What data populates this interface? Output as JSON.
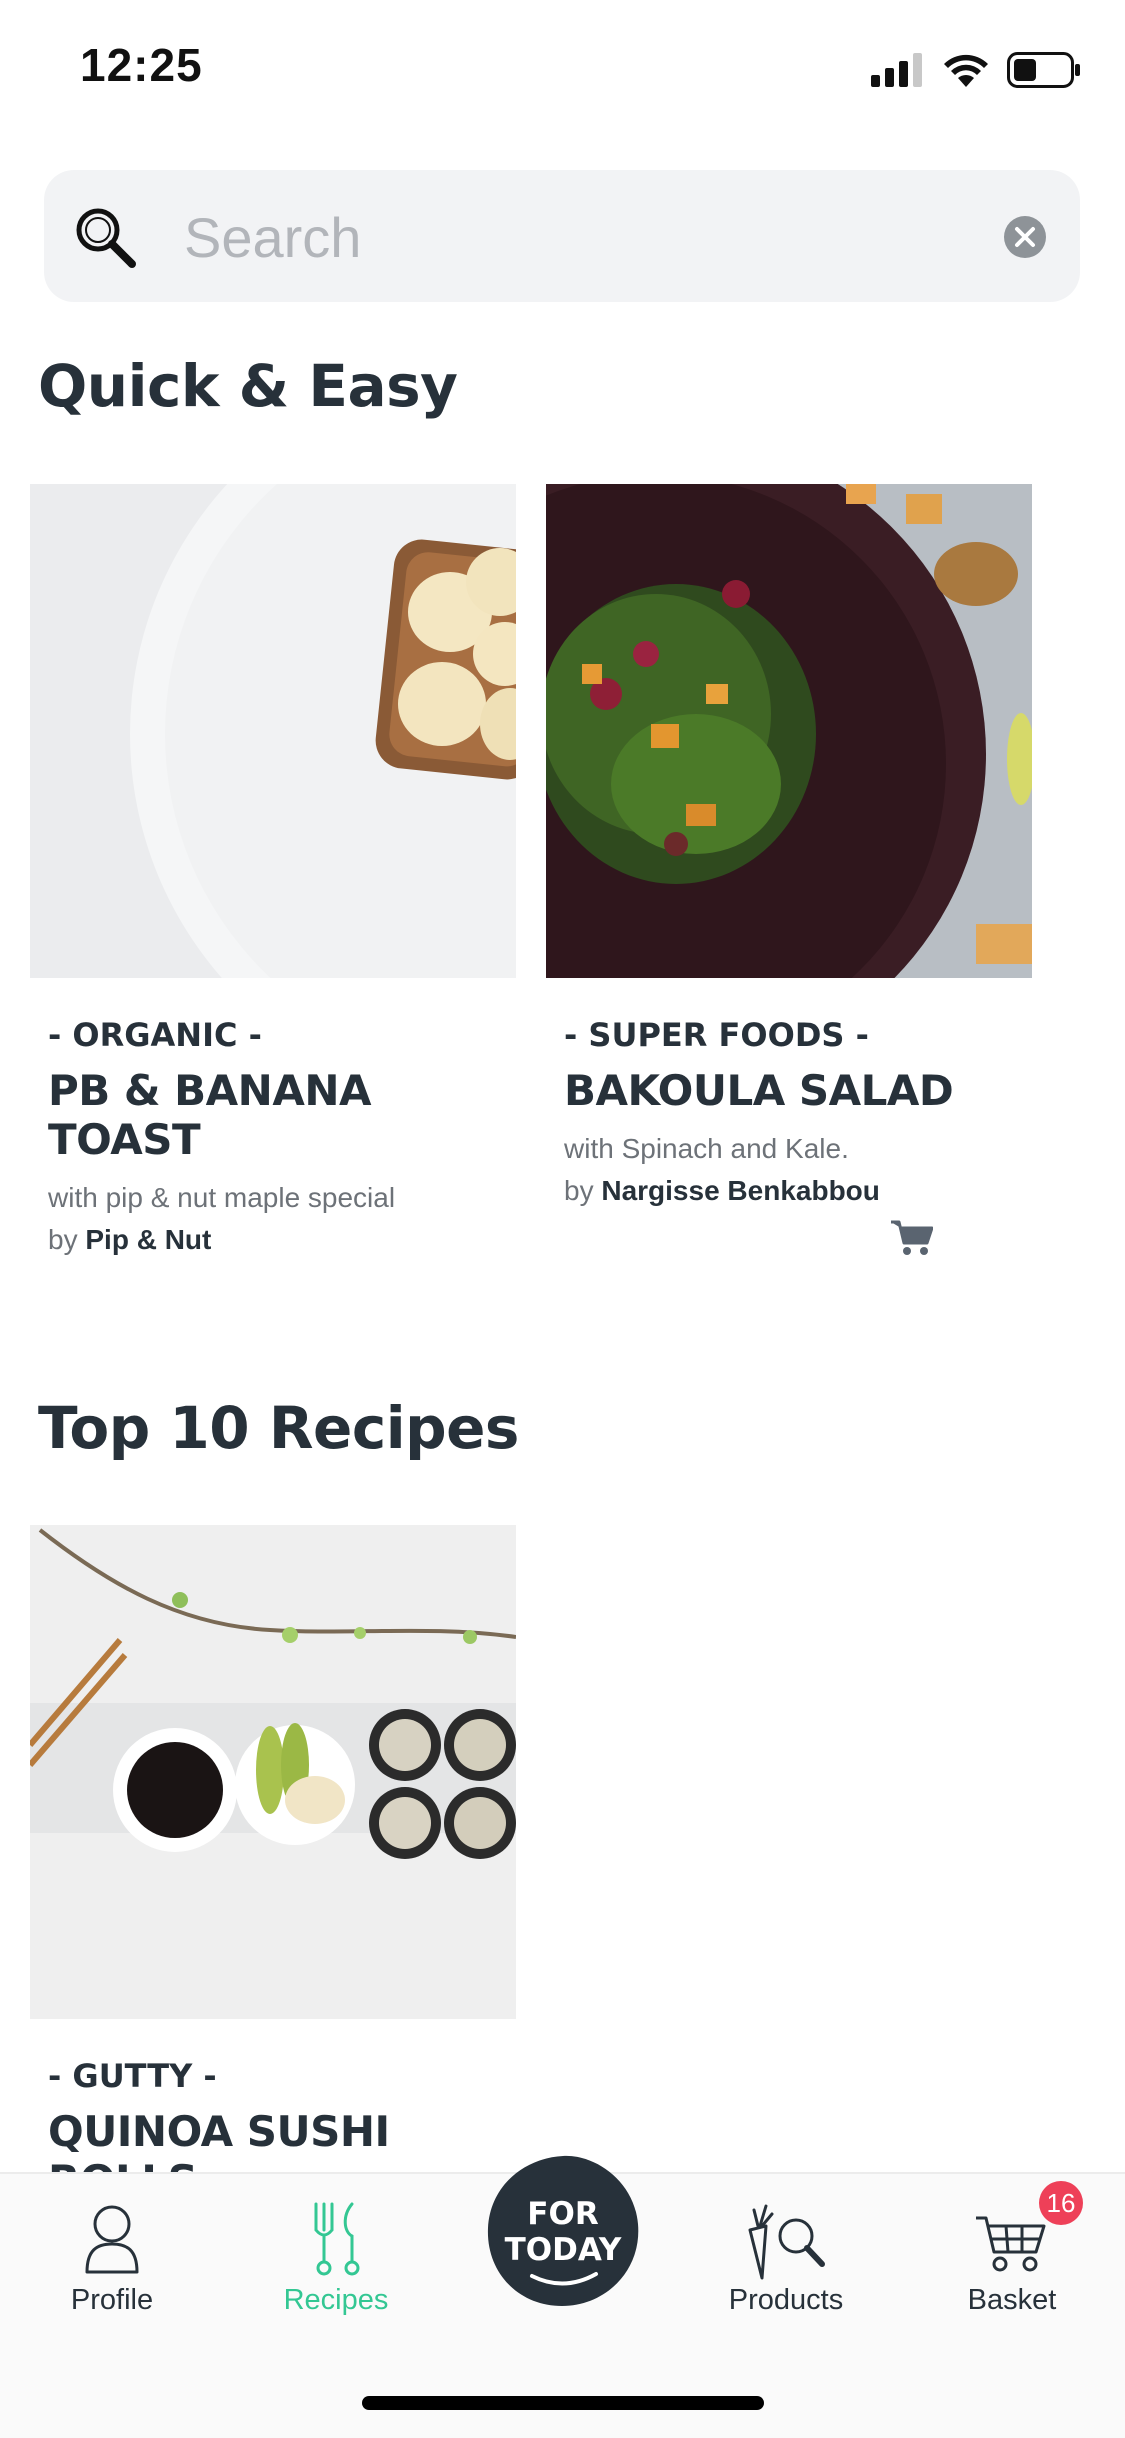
{
  "status_bar": {
    "time": "12:25"
  },
  "search": {
    "placeholder": "Search",
    "value": ""
  },
  "sections": {
    "quick_easy": {
      "title": "Quick & Easy",
      "cards": [
        {
          "category": "- ORGANIC -",
          "title": "PB & BANANA TOAST",
          "subtitle": "with pip & nut maple special",
          "by": "by",
          "author": "Pip & Nut"
        },
        {
          "category": "- SUPER FOODS -",
          "title": "BAKOULA SALAD",
          "subtitle": "with Spinach and Kale.",
          "by": "by",
          "author": "Nargisse Benkabbou"
        }
      ]
    },
    "top_recipes": {
      "title": "Top 10 Recipes",
      "cards": [
        {
          "category": "- GUTTY -",
          "title": "QUINOA SUSHI ROLLS"
        }
      ]
    }
  },
  "tab_bar": {
    "items": [
      {
        "label": "Profile",
        "icon": "person-icon"
      },
      {
        "label": "Recipes",
        "icon": "fork-spoon-icon",
        "active": true
      },
      {
        "label": "FOR TODAY",
        "line1": "FOR",
        "line2": "TODAY"
      },
      {
        "label": "Products",
        "icon": "carrot-search-icon"
      },
      {
        "label": "Basket",
        "icon": "basket-icon",
        "badge": "16"
      }
    ]
  },
  "colors": {
    "accent": "#33c793",
    "text": "#27313a",
    "badge": "#ee4058"
  }
}
